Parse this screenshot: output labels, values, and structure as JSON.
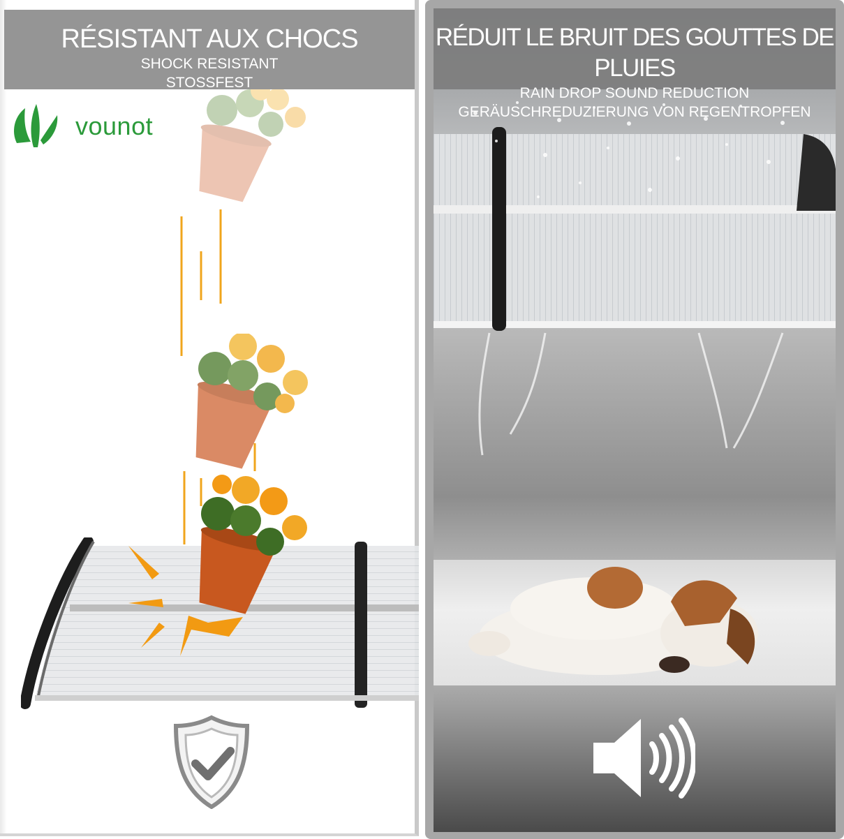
{
  "left": {
    "title": "RÉSISTANT AUX CHOCS",
    "subtitle_en": "SHOCK RESISTANT",
    "subtitle_de": "STOSSFEST",
    "brand": "vounot",
    "icons": [
      "leaf-logo-icon",
      "flower-pot-icon",
      "impact-burst-icon",
      "shield-check-icon"
    ],
    "colors": {
      "banner": "#959595",
      "brand_green": "#2b9a3a",
      "motion_lines": "#f0a51c",
      "pot": "#d06a3a"
    }
  },
  "right": {
    "title": "RÉDUIT LE BRUIT DES GOUTTES DE PLUIES",
    "subtitle_en": "RAIN DROP SOUND REDUCTION",
    "subtitle_de": "GERÄUSCHREDUZIERUNG VON REGENTROPFEN",
    "icons": [
      "rain-canopy-photo",
      "sleeping-dog-photo",
      "speaker-sound-icon"
    ],
    "colors": {
      "banner": "#7d7d7d"
    }
  }
}
